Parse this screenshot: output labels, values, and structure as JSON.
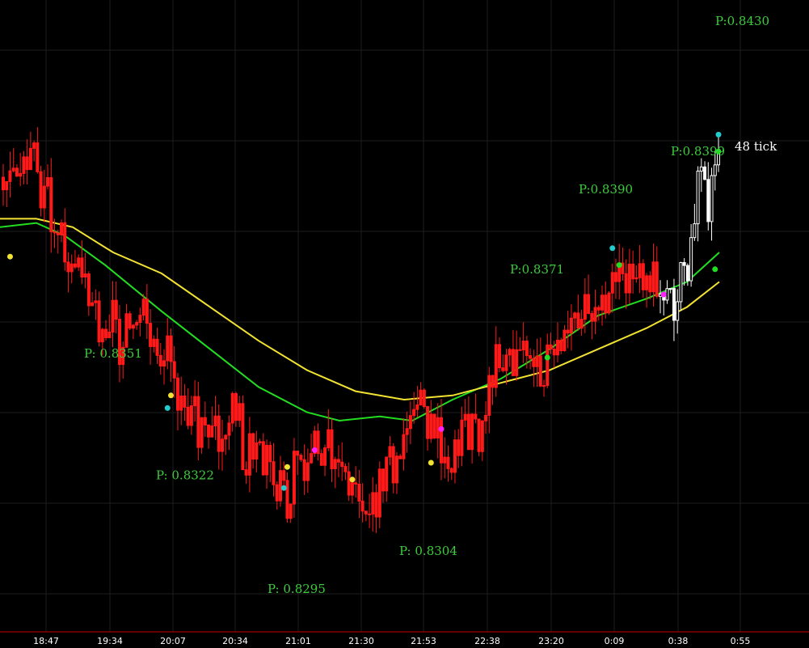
{
  "chart_data": {
    "type": "candlestick",
    "x_tick_labels": [
      "18:47",
      "19:34",
      "20:07",
      "20:34",
      "21:01",
      "21:30",
      "21:53",
      "22:38",
      "23:20",
      "0:09",
      "0:38",
      "0:55"
    ],
    "tick_label": "48 tick",
    "price_annotations": [
      {
        "text": "P:0.8430",
        "price": 0.843
      },
      {
        "text": "P:0.8399",
        "price": 0.8399
      },
      {
        "text": "P:0.8390",
        "price": 0.839
      },
      {
        "text": "P:0.8371",
        "price": 0.8371
      },
      {
        "text": "P: 0.8351",
        "price": 0.8351
      },
      {
        "text": "P: 0.8322",
        "price": 0.8322
      },
      {
        "text": "P: 0.8304",
        "price": 0.8304
      },
      {
        "text": "P: 0.8295",
        "price": 0.8295
      }
    ],
    "price_range": [
      0.8285,
      0.8435
    ],
    "grid": true,
    "colors": {
      "background": "#000000",
      "grid": "#1e1e1e",
      "down_candle": "#ff1a1a",
      "up_candle": "#ffffff",
      "ma_fast": "#22dd22",
      "ma_slow": "#f2e232",
      "annotation": "#3ccc3c",
      "axis_line": "#cc0000"
    },
    "series": [
      {
        "type": "moving-average",
        "color": "ma_fast",
        "points": [
          [
            0,
            0.8381
          ],
          [
            45,
            0.8382
          ],
          [
            80,
            0.8379
          ],
          [
            130,
            0.8372
          ],
          [
            200,
            0.8361
          ],
          [
            260,
            0.8352
          ],
          [
            320,
            0.8343
          ],
          [
            380,
            0.8337
          ],
          [
            420,
            0.8335
          ],
          [
            470,
            0.8336
          ],
          [
            510,
            0.8335
          ],
          [
            560,
            0.834
          ],
          [
            620,
            0.8345
          ],
          [
            680,
            0.8352
          ],
          [
            740,
            0.836
          ],
          [
            800,
            0.8364
          ],
          [
            850,
            0.8368
          ],
          [
            890,
            0.8375
          ]
        ]
      },
      {
        "type": "moving-average",
        "color": "ma_slow",
        "points": [
          [
            0,
            0.8383
          ],
          [
            45,
            0.8383
          ],
          [
            90,
            0.8381
          ],
          [
            140,
            0.8375
          ],
          [
            200,
            0.837
          ],
          [
            260,
            0.8362
          ],
          [
            320,
            0.8354
          ],
          [
            380,
            0.8347
          ],
          [
            440,
            0.8342
          ],
          [
            500,
            0.834
          ],
          [
            560,
            0.8341
          ],
          [
            620,
            0.8344
          ],
          [
            680,
            0.8347
          ],
          [
            740,
            0.8352
          ],
          [
            800,
            0.8357
          ],
          [
            850,
            0.8362
          ],
          [
            890,
            0.8368
          ]
        ]
      }
    ],
    "markers": [
      {
        "i": 2,
        "price": 0.8374,
        "color": "#f2e232"
      },
      {
        "i": 49,
        "price": 0.8341,
        "color": "#f2e232"
      },
      {
        "i": 48,
        "price": 0.8338,
        "color": "#22cccc"
      },
      {
        "i": 83,
        "price": 0.8324,
        "color": "#f2e232"
      },
      {
        "i": 82,
        "price": 0.8319,
        "color": "#22cccc"
      },
      {
        "i": 91,
        "price": 0.8328,
        "color": "#ff22ff"
      },
      {
        "i": 102,
        "price": 0.8321,
        "color": "#f2e232"
      },
      {
        "i": 128,
        "price": 0.8333,
        "color": "#ff22ff"
      },
      {
        "i": 125,
        "price": 0.8325,
        "color": "#f2e232"
      },
      {
        "i": 159,
        "price": 0.835,
        "color": "#22dd22"
      },
      {
        "i": 178,
        "price": 0.8376,
        "color": "#22cccc"
      },
      {
        "i": 180,
        "price": 0.8372,
        "color": "#22dd22"
      },
      {
        "i": 193,
        "price": 0.8365,
        "color": "#ff22ff"
      },
      {
        "i": 208,
        "price": 0.8371,
        "color": "#22dd22"
      },
      {
        "i": 220,
        "price": 0.8403,
        "color": "#22cccc"
      },
      {
        "i": 221,
        "price": 0.8399,
        "color": "#22dd22"
      }
    ],
    "segments": [
      {
        "from": 0.8391,
        "to": 0.8396,
        "n": 10,
        "sd": 0.0004
      },
      {
        "from": 0.8396,
        "to": 0.8374,
        "n": 10,
        "sd": 0.0006
      },
      {
        "from": 0.8374,
        "to": 0.8355,
        "n": 12,
        "sd": 0.0005
      },
      {
        "from": 0.8355,
        "to": 0.836,
        "n": 10,
        "sd": 0.0005
      },
      {
        "from": 0.836,
        "to": 0.8333,
        "n": 14,
        "sd": 0.0005
      },
      {
        "from": 0.8333,
        "to": 0.8333,
        "n": 14,
        "sd": 0.0006
      },
      {
        "from": 0.8333,
        "to": 0.832,
        "n": 14,
        "sd": 0.0005
      },
      {
        "from": 0.832,
        "to": 0.8326,
        "n": 12,
        "sd": 0.0005
      },
      {
        "from": 0.8326,
        "to": 0.8314,
        "n": 12,
        "sd": 0.0004
      },
      {
        "from": 0.8314,
        "to": 0.8337,
        "n": 14,
        "sd": 0.0005
      },
      {
        "from": 0.8337,
        "to": 0.8326,
        "n": 12,
        "sd": 0.0005
      },
      {
        "from": 0.8326,
        "to": 0.835,
        "n": 12,
        "sd": 0.0006
      },
      {
        "from": 0.835,
        "to": 0.8346,
        "n": 12,
        "sd": 0.0005
      },
      {
        "from": 0.8346,
        "to": 0.8364,
        "n": 14,
        "sd": 0.0004
      },
      {
        "from": 0.8364,
        "to": 0.8369,
        "n": 14,
        "sd": 0.0005
      },
      {
        "from": 0.8369,
        "to": 0.8362,
        "n": 10,
        "sd": 0.0005
      },
      {
        "from": 0.8362,
        "to": 0.8402,
        "n": 14,
        "sd": 0.0007
      }
    ]
  }
}
